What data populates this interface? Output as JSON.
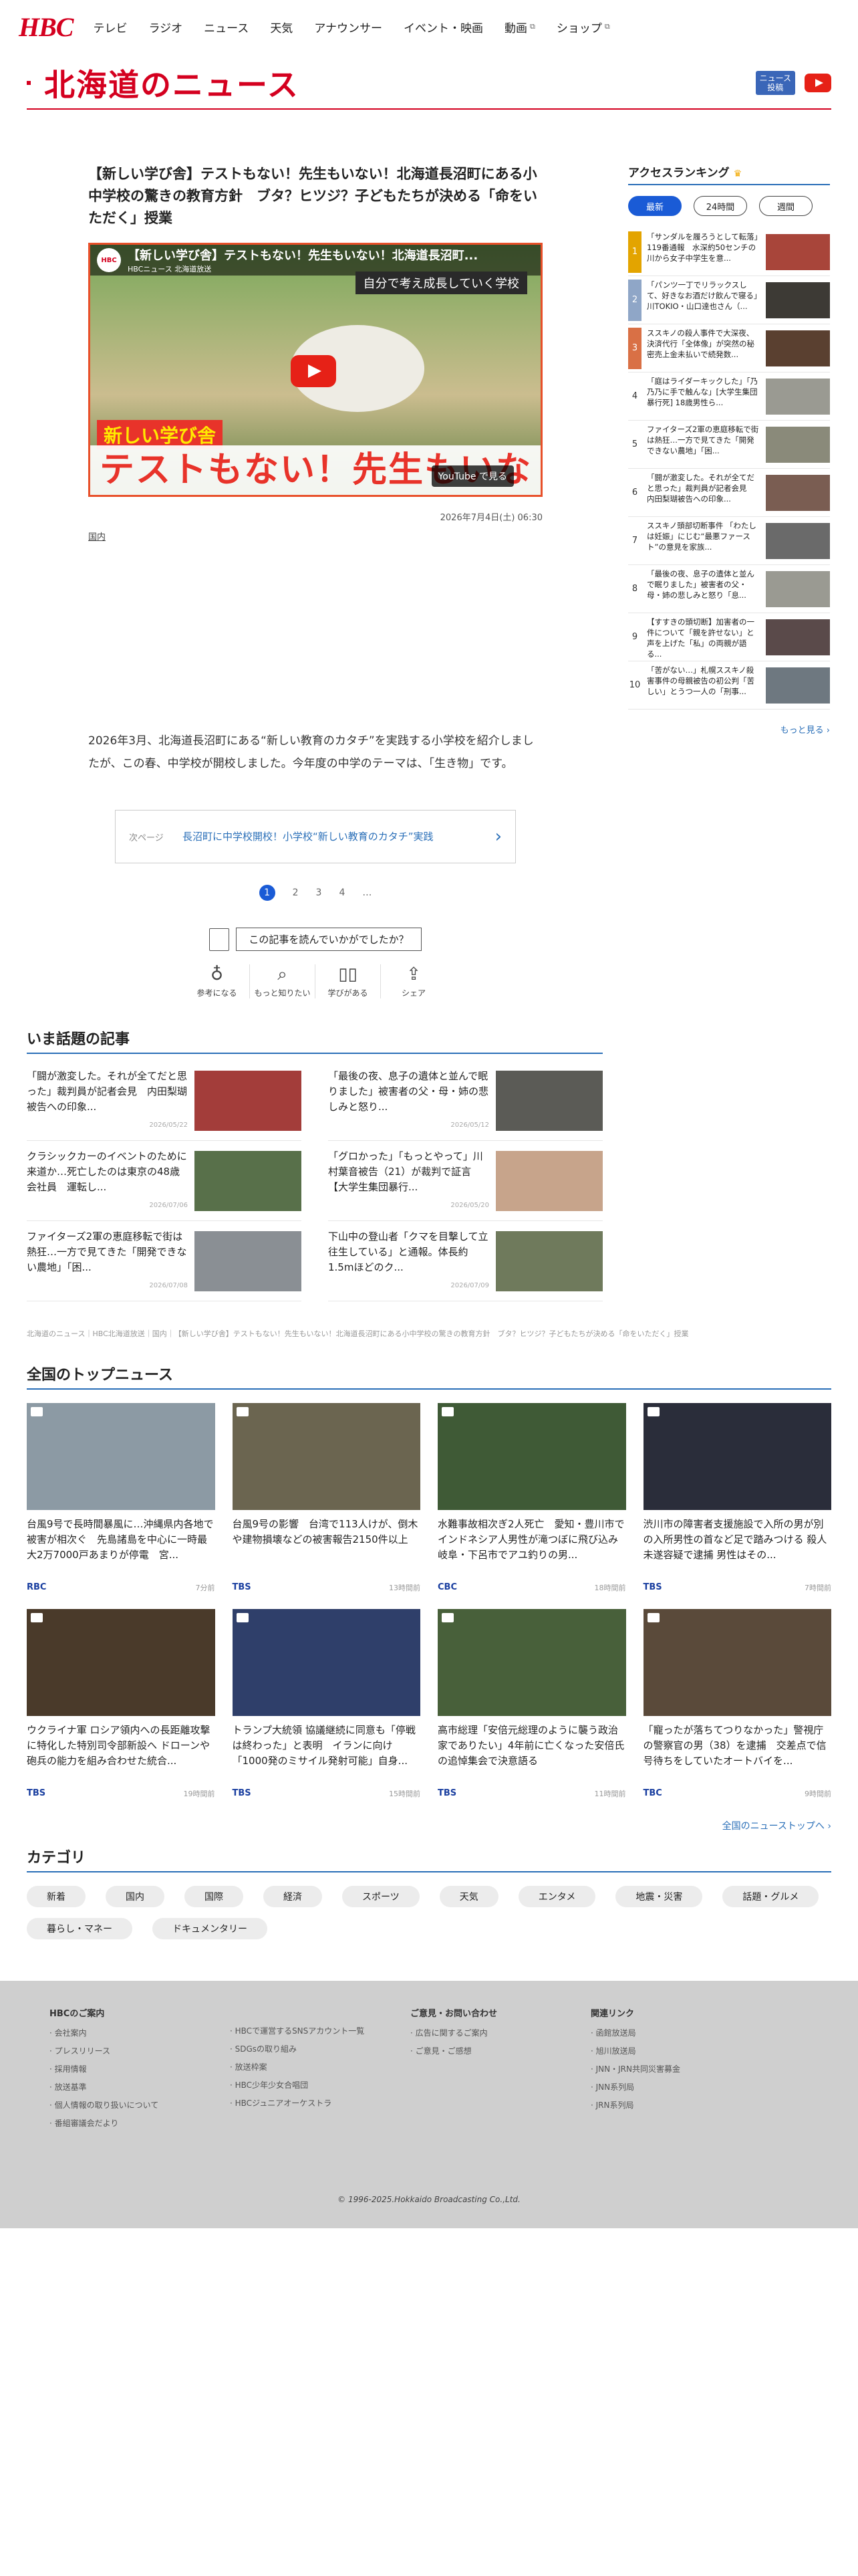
{
  "header": {
    "logo": "HBC",
    "nav": [
      {
        "label": "テレビ",
        "ext": false
      },
      {
        "label": "ラジオ",
        "ext": false
      },
      {
        "label": "ニュース",
        "ext": false
      },
      {
        "label": "天気",
        "ext": false
      },
      {
        "label": "アナウンサー",
        "ext": false
      },
      {
        "label": "イベント・映画",
        "ext": false
      },
      {
        "label": "動画",
        "ext": true
      },
      {
        "label": "ショップ",
        "ext": true
      }
    ],
    "page_title": "北海道のニュース",
    "news_post": "ニュース\n投稿"
  },
  "article": {
    "title": "【新しい学び舎】テストもない！先生もいない！北海道長沼町にある小中学校の驚きの教育方針　ブタ？ヒツジ？子どもたちが決める「命をいただく」授業",
    "video": {
      "channel": "HBC",
      "title": "【新しい学び舎】テストもない！先生もいない！北海道長沼町...",
      "channel_name": "HBCニュース 北海道放送",
      "badge": "自分で考え成長していく学校",
      "tag": "新しい学び舎",
      "big_text": "テストもない！先生もいない！",
      "yt": "YouTube で見る"
    },
    "date": "2026年7月4日(土) 06:30",
    "category": "国内",
    "lead": "2026年3月、北海道長沼町にある“新しい教育のカタチ”を実践する小学校を紹介しましたが、この春、中学校が開校しました。今年度の中学のテーマは、「生き物」です。",
    "next": {
      "label": "次ページ",
      "title": "長沼町に中学校開校！小学校“新しい教育のカタチ”実践"
    },
    "pager": [
      "1",
      "2",
      "3",
      "4",
      "…"
    ],
    "reaction": {
      "ask": "この記事を読んでいかがでしたか？",
      "buttons": [
        "参考になる",
        "もっと知りたい",
        "学びがある",
        "シェア"
      ]
    }
  },
  "ranking": {
    "title": "アクセスランキング",
    "tabs": [
      "最新",
      "24時間",
      "週間"
    ],
    "items": [
      {
        "n": "1",
        "text": "「サンダルを履ろうとして転落」119番通報　水深約50センチの川から女子中学生を意..."
      },
      {
        "n": "2",
        "text": "「パンツ一丁でリラックスして、好きなお酒だけ飲んで寝る」川TOKIO・山口達也さん（..."
      },
      {
        "n": "3",
        "text": "ススキノの殺人事件で大深夜、決済代行「全体像」が突然の秘密売上金未払いで続発数..."
      },
      {
        "n": "4",
        "text": "「庭はライダーキックした」「乃乃乃に手で触んな」[大学生集団暴行死] 18歳男性ら..."
      },
      {
        "n": "5",
        "text": "ファイターズ2軍の恵庭移転で街は熱狂…一方で見てきた「開発できない農地」「困..."
      },
      {
        "n": "6",
        "text": "「闘が激変した。それが全てだと思った」裁判員が記者会見　内田梨瑚被告への印象..."
      },
      {
        "n": "7",
        "text": "ススキノ頭部切断事件 「わたしは妊娠」にじむ“最悪ファースト”の意見を家族..."
      },
      {
        "n": "8",
        "text": "「最後の夜、息子の遺体と並んで眠りました」被害者の父・母・姉の悲しみと怒り「息..."
      },
      {
        "n": "9",
        "text": "【すすきの頭切断】加害者の一件について「親を許せない」と声を上げた「私」の両親が語る..."
      },
      {
        "n": "10",
        "text": "「苦がない…」札幌ススキノ殺害事件の母親被告の初公判「苦しい」とうつ一人の「刑事..."
      }
    ],
    "more": "もっと見る"
  },
  "trending": {
    "title": "いま話題の記事",
    "items": [
      {
        "text": "「闘が激変した。それが全てだと思った」裁判員が記者会見　内田梨瑚被告への印象...",
        "date": "2026/05/22"
      },
      {
        "text": "「最後の夜、息子の遺体と並んで眠りました」被害者の父・母・姉の悲しみと怒り...",
        "date": "2026/05/12"
      },
      {
        "text": "クラシックカーのイベントのために来道か…死亡したのは東京の48歳会社員　運転し...",
        "date": "2026/07/06"
      },
      {
        "text": "「グロかった」「もっとやって」川村葉音被告（21）が裁判で証言【大学生集団暴行...",
        "date": "2026/05/20"
      },
      {
        "text": "ファイターズ2軍の恵庭移転で街は熱狂…一方で見てきた「開発できない農地」「困...",
        "date": "2026/07/08"
      },
      {
        "text": "下山中の登山者「クマを目撃して立往生している」と通報。体長約1.5mほどのク...",
        "date": "2026/07/09"
      }
    ]
  },
  "breadcrumb": "北海道のニュース｜HBC北海道放送｜国内｜【新しい学び舎】テストもない！先生もいない！北海道長沼町にある小中学校の驚きの教育方針　ブタ？ヒツジ？子どもたちが決める「命をいただく」授業",
  "national": {
    "title": "全国のトップニュース",
    "items": [
      {
        "text": "台風9号で長時間暴風に…沖縄県内各地で被害が相次ぐ　先島諸島を中心に一時最大2万7000戸あまりが停電　宮...",
        "src": "RBC",
        "ago": "7分前"
      },
      {
        "text": "台風9号の影響　台湾で113人けが、倒木や建物損壊などの被害報告2150件以上",
        "src": "TBS",
        "ago": "13時間前"
      },
      {
        "text": "水難事故相次ぎ2人死亡　愛知・豊川市でインドネシア人男性が滝つぼに飛び込み　岐阜・下呂市でアユ釣りの男...",
        "src": "CBC",
        "ago": "18時間前"
      },
      {
        "text": "渋川市の障害者支援施設で入所の男が別の入所男性の首など足で踏みつける 殺人未遂容疑で逮捕 男性はその...",
        "src": "TBS",
        "ago": "7時間前"
      },
      {
        "text": "ウクライナ軍 ロシア領内への長距離攻撃に特化した特別司令部新設へ ドローンや砲兵の能力を組み合わせた統合...",
        "src": "TBS",
        "ago": "19時間前"
      },
      {
        "text": "トランプ大統領 協議継続に同意も「停戦は終わった」と表明　イランに向け「1000発のミサイル発射可能」自身...",
        "src": "TBS",
        "ago": "15時間前"
      },
      {
        "text": "高市総理「安倍元総理のように襲う政治家でありたい」4年前に亡くなった安倍氏の追悼集会で決意語る",
        "src": "TBS",
        "ago": "11時間前"
      },
      {
        "text": "「寵ったが落ちてつりなかった」警視庁の警察官の男（38）を逮捕　交差点で信号待ちをしていたオートバイを...",
        "src": "TBC",
        "ago": "9時間前"
      }
    ],
    "all_label": "全国のニューストップへ"
  },
  "categories": {
    "title": "カテゴリ",
    "items": [
      "新着",
      "国内",
      "国際",
      "経済",
      "スポーツ",
      "天気",
      "エンタメ",
      "地震・災害",
      "話題・グルメ",
      "暮らし・マネー",
      "ドキュメンタリー"
    ]
  },
  "footer": {
    "cols": [
      {
        "head": "HBCのご案内",
        "links": [
          "会社案内",
          "プレスリリース",
          "採用情報",
          "放送基準",
          "個人情報の取り扱いについて",
          "番組審議会だより"
        ]
      },
      {
        "head": "",
        "links": [
          "HBCで運営するSNSアカウント一覧",
          "SDGsの取り組み",
          "放送枠案",
          "HBC少年少女合唱団",
          "HBCジュニアオーケストラ"
        ]
      },
      {
        "head": "ご意見・お問い合わせ",
        "links": [
          "広告に関するご案内",
          "ご意見・ご感想"
        ]
      },
      {
        "head": "関連リンク",
        "links": [
          "函館放送局",
          "旭川放送局",
          "JNN・JRN共同災害募金",
          "JNN系列局",
          "JRN系列局"
        ]
      }
    ],
    "copyright": "© 1996-2025.Hokkaido Broadcasting Co.,Ltd."
  },
  "colors": {
    "brand": "#d4001f",
    "accent": "#1a5bd6",
    "link": "#2a6fb8"
  }
}
